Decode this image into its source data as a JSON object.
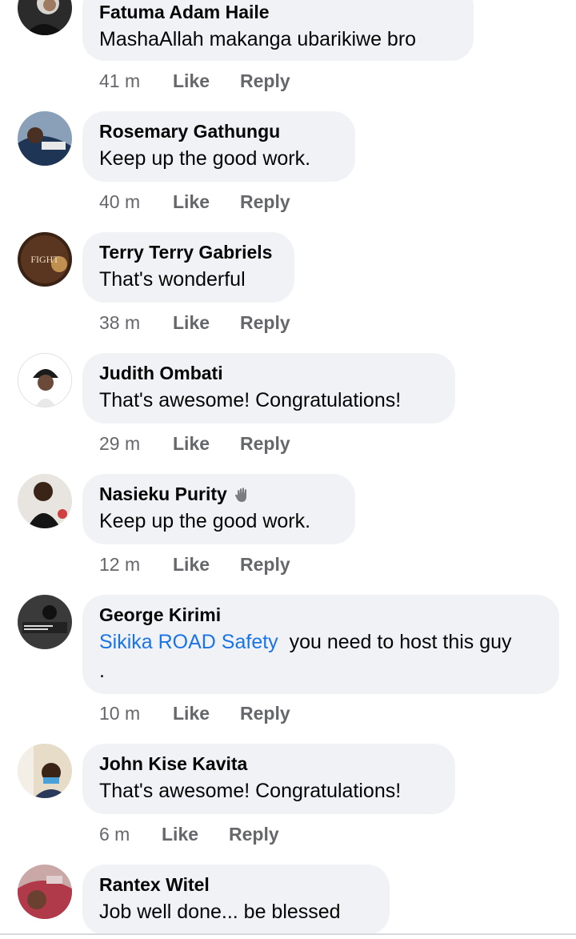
{
  "comments": [
    {
      "name": "Fatuma Adam Haile",
      "text": "MashaAllah makanga ubarikiwe bro",
      "time": "41 m",
      "like": "Like",
      "reply": "Reply"
    },
    {
      "name": "Rosemary Gathungu",
      "text": "Keep up the good work.",
      "time": "40 m",
      "like": "Like",
      "reply": "Reply"
    },
    {
      "name": "Terry Terry Gabriels",
      "text": "That's wonderful",
      "time": "38 m",
      "like": "Like",
      "reply": "Reply",
      "avatar_text": "FIGHT"
    },
    {
      "name": "Judith Ombati",
      "text": "That's awesome! Congratulations!",
      "time": "29 m",
      "like": "Like",
      "reply": "Reply"
    },
    {
      "name": "Nasieku Purity",
      "text": "Keep up the good work.",
      "time": "12 m",
      "like": "Like",
      "reply": "Reply",
      "badge_icon": "waving-hand"
    },
    {
      "name": "George Kirimi",
      "mention": "Sikika ROAD Safety",
      "text": "you need to host this guy .",
      "time": "10 m",
      "like": "Like",
      "reply": "Reply"
    },
    {
      "name": "John Kise Kavita",
      "text": "That's awesome! Congratulations!",
      "time": "6 m",
      "like": "Like",
      "reply": "Reply"
    },
    {
      "name": "Rantex Witel",
      "text": "Job well done... be blessed"
    }
  ],
  "colors": {
    "bubble": "#f0f2f5",
    "meta": "#65676b",
    "mention": "#1b74e4"
  }
}
